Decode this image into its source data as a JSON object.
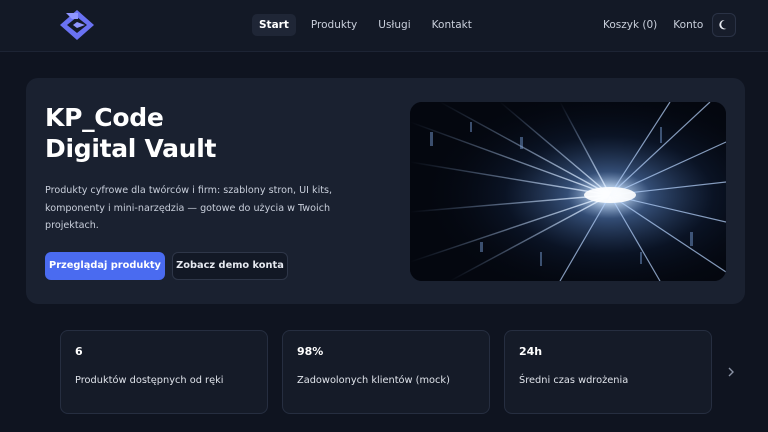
{
  "header": {
    "logo": "kp-code-logo",
    "nav": [
      {
        "label": "Start",
        "active": true
      },
      {
        "label": "Produkty",
        "active": false
      },
      {
        "label": "Usługi",
        "active": false
      },
      {
        "label": "Kontakt",
        "active": false
      }
    ],
    "cart_label": "Koszyk (0)",
    "account_label": "Konto",
    "theme_icon": "moon-icon"
  },
  "hero": {
    "title_line1": "KP_Code",
    "title_line2": "Digital Vault",
    "description": "Produkty cyfrowe dla twórców i firm: szablony stron, UI kits, komponenty i mini-narzędzia — gotowe do użycia w Twoich projektach.",
    "primary_button": "Przeglądaj produkty",
    "secondary_button": "Zobacz demo konta",
    "image": "digital-light-tunnel-image"
  },
  "stats": [
    {
      "value": "6",
      "label": "Produktów dostępnych od ręki"
    },
    {
      "value": "98%",
      "label": "Zadowolonych klientów (mock)"
    },
    {
      "value": "24h",
      "label": "Średni czas wdrożenia"
    }
  ],
  "colors": {
    "background": "#0f1420",
    "panel": "#1a2130",
    "accent": "#4a6bf0",
    "logo": "#6a72f2"
  }
}
